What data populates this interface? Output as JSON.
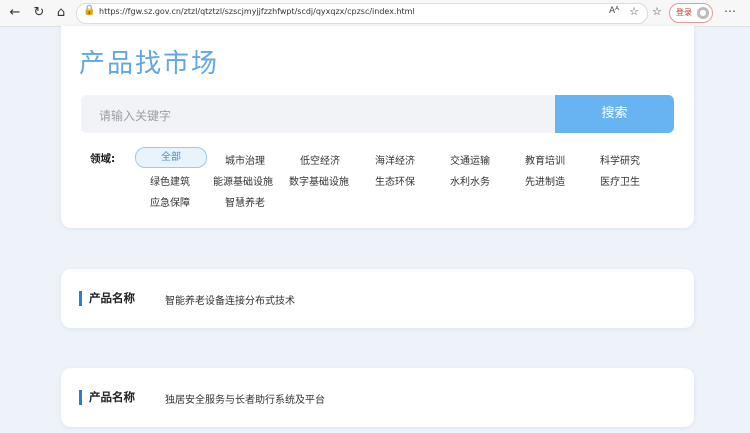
{
  "browser": {
    "url": "https://fgw.sz.gov.cn/ztzl/qtztzl/szscjmyjjfzzhfwpt/scdj/qyxqzx/cpzsc/index.html",
    "login_label": "登录",
    "icons": {
      "back": "back-arrow-icon",
      "refresh": "refresh-icon",
      "home": "home-icon",
      "lock": "lock-icon",
      "read_aloud": "read-aloud-icon",
      "favorite": "star-icon",
      "favorites_bar": "favorites-icon",
      "profile": "avatar-icon",
      "more": "more-icon"
    },
    "read_aloud_text": "Aᴬ"
  },
  "page": {
    "title": "产品找市场",
    "search": {
      "placeholder": "请输入关键字",
      "button_label": "搜索"
    },
    "field_label": "领域:",
    "tags": [
      {
        "label": "全部",
        "active": true
      },
      {
        "label": "城市治理"
      },
      {
        "label": "低空经济"
      },
      {
        "label": "海洋经济"
      },
      {
        "label": "交通运输"
      },
      {
        "label": "教育培训"
      },
      {
        "label": "科学研究"
      },
      {
        "label": "绿色建筑"
      },
      {
        "label": "能源基础设施"
      },
      {
        "label": "数字基础设施"
      },
      {
        "label": "生态环保"
      },
      {
        "label": "水利水务"
      },
      {
        "label": "先进制造"
      },
      {
        "label": "医疗卫生"
      },
      {
        "label": "应急保障"
      },
      {
        "label": "智慧养老"
      }
    ]
  },
  "products": [
    {
      "label": "产品名称",
      "name": "智能养老设备连接分布式技术"
    },
    {
      "label": "产品名称",
      "name": "独居安全服务与长者助行系统及平台"
    }
  ],
  "colors": {
    "accent": "#5fa7e6",
    "button": "#68b4f2",
    "marker": "#2e7ad1",
    "background": "#eef3fa"
  }
}
